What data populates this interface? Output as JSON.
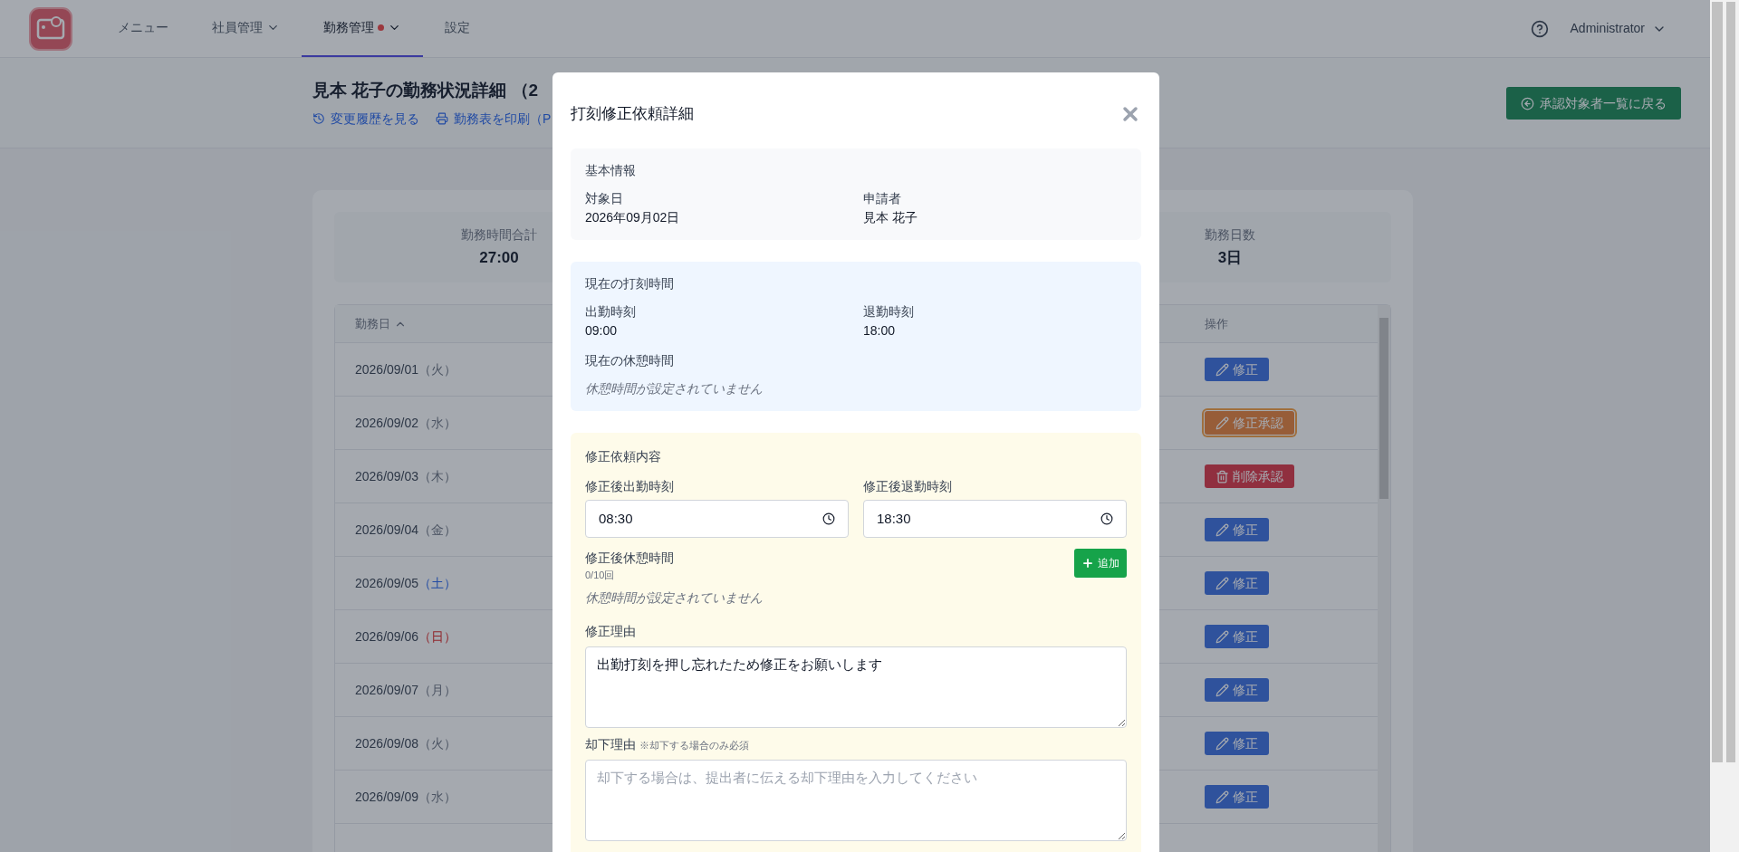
{
  "nav": {
    "items": [
      {
        "label": "メニュー",
        "selected": false,
        "dropdown": false,
        "notice": false
      },
      {
        "label": "社員管理",
        "selected": false,
        "dropdown": true,
        "notice": false
      },
      {
        "label": "勤務管理",
        "selected": true,
        "dropdown": true,
        "notice": true
      },
      {
        "label": "設定",
        "selected": false,
        "dropdown": false,
        "notice": false
      }
    ],
    "user": "Administrator"
  },
  "page": {
    "title": "見本 花子の勤務状況詳細 （2",
    "links": [
      "変更履歴を見る",
      "勤務表を印刷（P"
    ],
    "back_button": "承認対象者一覧に戻る"
  },
  "summary": [
    {
      "label": "勤務時間合計",
      "value": "27:00"
    },
    {
      "label": "勤務日数",
      "value": "3日"
    }
  ],
  "table": {
    "columns": [
      {
        "label": "勤務日",
        "sorted_ascending": true
      },
      {
        "label": "操作",
        "sorted_ascending": false
      }
    ],
    "rows": [
      {
        "date": "2026/09/01",
        "weekday": "（火）",
        "saturday": false,
        "sunday": false,
        "action": {
          "kind": "edit",
          "label": "修正",
          "focused": false
        }
      },
      {
        "date": "2026/09/02",
        "weekday": "（水）",
        "saturday": false,
        "sunday": false,
        "action": {
          "kind": "approve_edit",
          "label": "修正承認",
          "focused": true
        }
      },
      {
        "date": "2026/09/03",
        "weekday": "（木）",
        "saturday": false,
        "sunday": false,
        "action": {
          "kind": "approve_delete",
          "label": "削除承認",
          "focused": false
        }
      },
      {
        "date": "2026/09/04",
        "weekday": "（金）",
        "saturday": false,
        "sunday": false,
        "action": {
          "kind": "edit",
          "label": "修正",
          "focused": false
        }
      },
      {
        "date": "2026/09/05",
        "weekday": "（土）",
        "saturday": true,
        "sunday": false,
        "action": {
          "kind": "edit",
          "label": "修正",
          "focused": false
        }
      },
      {
        "date": "2026/09/06",
        "weekday": "（日）",
        "saturday": false,
        "sunday": true,
        "action": {
          "kind": "edit",
          "label": "修正",
          "focused": false
        }
      },
      {
        "date": "2026/09/07",
        "weekday": "（月）",
        "saturday": false,
        "sunday": false,
        "action": {
          "kind": "edit",
          "label": "修正",
          "focused": false
        }
      },
      {
        "date": "2026/09/08",
        "weekday": "（火）",
        "saturday": false,
        "sunday": false,
        "action": {
          "kind": "edit",
          "label": "修正",
          "focused": false
        }
      },
      {
        "date": "2026/09/09",
        "weekday": "（水）",
        "saturday": false,
        "sunday": false,
        "action": {
          "kind": "edit",
          "label": "修正",
          "focused": false
        }
      }
    ]
  },
  "modal": {
    "title": "打刻修正依頼詳細",
    "basic": {
      "heading": "基本情報",
      "fields": [
        {
          "label": "対象日",
          "value": "2026年09月02日"
        },
        {
          "label": "申請者",
          "value": "見本 花子"
        }
      ]
    },
    "current": {
      "heading": "現在の打刻時間",
      "fields": [
        {
          "label": "出勤時刻",
          "value": "09:00"
        },
        {
          "label": "退勤時刻",
          "value": "18:00"
        }
      ],
      "break_heading": "現在の休憩時間",
      "break_empty": "休憩時間が設定されていません"
    },
    "request": {
      "heading": "修正依頼内容",
      "times": [
        {
          "label": "修正後出勤時刻",
          "value": "08:30"
        },
        {
          "label": "修正後退勤時刻",
          "value": "18:30"
        }
      ],
      "break_label": "修正後休憩時間",
      "break_count": "0/10回",
      "add_button": "追加",
      "break_empty": "休憩時間が設定されていません",
      "reason_label": "修正理由",
      "reason_value": "出勤打刻を押し忘れたため修正をお願いします",
      "reject_label": "却下理由",
      "reject_note": "※却下する場合のみ必須",
      "reject_placeholder": "却下する場合は、提出者に伝える却下理由を入力してください"
    }
  }
}
